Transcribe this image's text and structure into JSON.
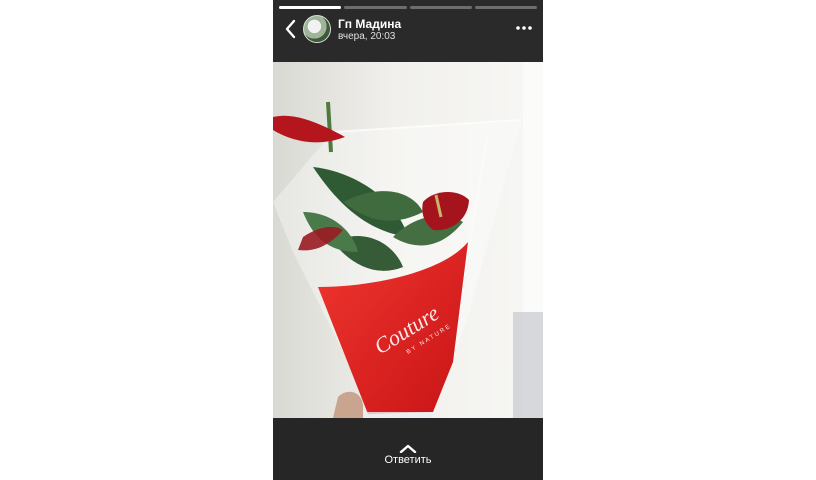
{
  "story": {
    "author": "Гп Мадина",
    "timestamp": "вчера, 20:03",
    "progress": [
      1.0,
      0.0,
      0.0,
      0.0
    ],
    "segments_count": 4,
    "reply_label": "Ответить",
    "icons": {
      "back": "chevron-left-icon",
      "menu": "more-horizontal-icon",
      "reply": "chevron-up-icon"
    }
  },
  "photo": {
    "description_label": "Couture",
    "subtitle_label": "BY NATURE"
  },
  "colors": {
    "background": "#ffffff",
    "story_bg": "#2a2a2a",
    "progress_active": "#ffffff",
    "progress_inactive": "#6d6d6d",
    "wrapper_red": "#e2201f"
  }
}
